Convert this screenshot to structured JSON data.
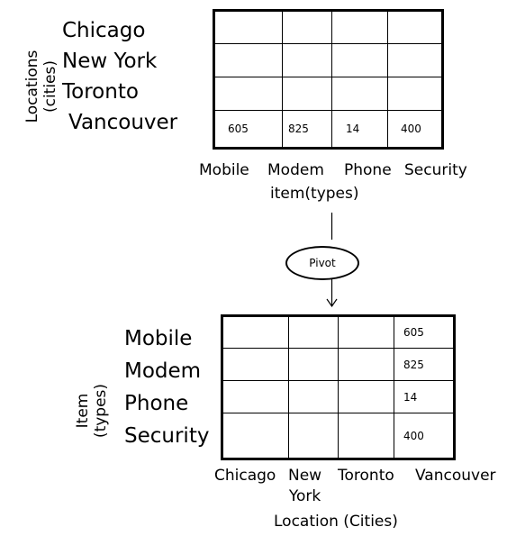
{
  "top": {
    "side_title": "Locations\n(cities)",
    "rows": [
      "Chicago",
      "New York",
      "Toronto",
      "Vancouver"
    ],
    "columns": [
      "Mobile",
      "Modem",
      "Phone",
      "Security"
    ],
    "column_title": "item(types)",
    "values_row": [
      "605",
      "825",
      "14",
      "400"
    ]
  },
  "pivot": {
    "label": "Pivot"
  },
  "bottom": {
    "side_title": "Item\n(types)",
    "rows": [
      "Mobile",
      "Modem",
      "Phone",
      "Security"
    ],
    "columns": [
      "Chicago",
      "New\nYork",
      "Toronto",
      "Vancouver"
    ],
    "column_title": "Location (Cities)",
    "values_col": [
      "605",
      "825",
      "14",
      "400"
    ]
  }
}
